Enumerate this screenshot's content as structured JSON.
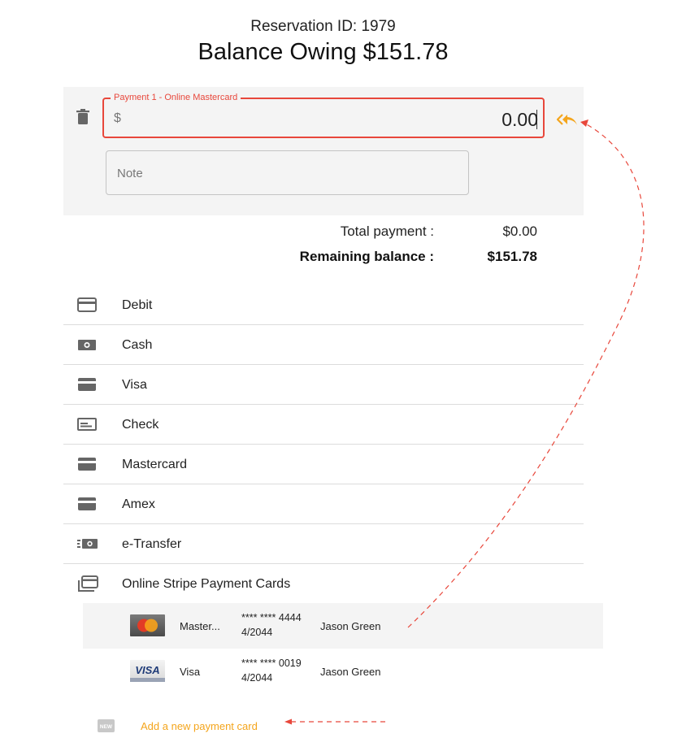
{
  "header": {
    "reservation_id": "Reservation ID: 1979",
    "balance_owing": "Balance Owing $151.78"
  },
  "payment": {
    "legend": "Payment 1 - Online Mastercard",
    "currency_symbol": "$",
    "amount": "0.00",
    "note_placeholder": "Note"
  },
  "summary": {
    "total_label": "Total payment :",
    "total_value": "$0.00",
    "remaining_label": "Remaining balance :",
    "remaining_value": "$151.78"
  },
  "methods": [
    {
      "label": "Debit",
      "icon": "credit-card-icon"
    },
    {
      "label": "Cash",
      "icon": "cash-icon"
    },
    {
      "label": "Visa",
      "icon": "card-icon"
    },
    {
      "label": "Check",
      "icon": "check-icon"
    },
    {
      "label": "Mastercard",
      "icon": "card-icon"
    },
    {
      "label": "Amex",
      "icon": "card-icon"
    },
    {
      "label": "e-Transfer",
      "icon": "e-transfer-icon"
    }
  ],
  "online_section": {
    "label": "Online Stripe Payment Cards",
    "icon": "card-stack-icon"
  },
  "saved_cards": [
    {
      "brand": "Master...",
      "number": "**** **** 4444",
      "expiry": "4/2044",
      "holder": "Jason Green",
      "logo": "mastercard-logo",
      "selected": true
    },
    {
      "brand": "Visa",
      "number": "**** **** 0019",
      "expiry": "4/2044",
      "holder": "Jason Green",
      "logo": "visa-logo",
      "logo_text": "VISA",
      "selected": false
    }
  ],
  "add_card": {
    "badge": "NEW",
    "label": "Add a new payment card"
  },
  "colors": {
    "accent_red": "#e8473b",
    "accent_orange": "#f4a51c",
    "panel_bg": "#f4f4f4"
  }
}
